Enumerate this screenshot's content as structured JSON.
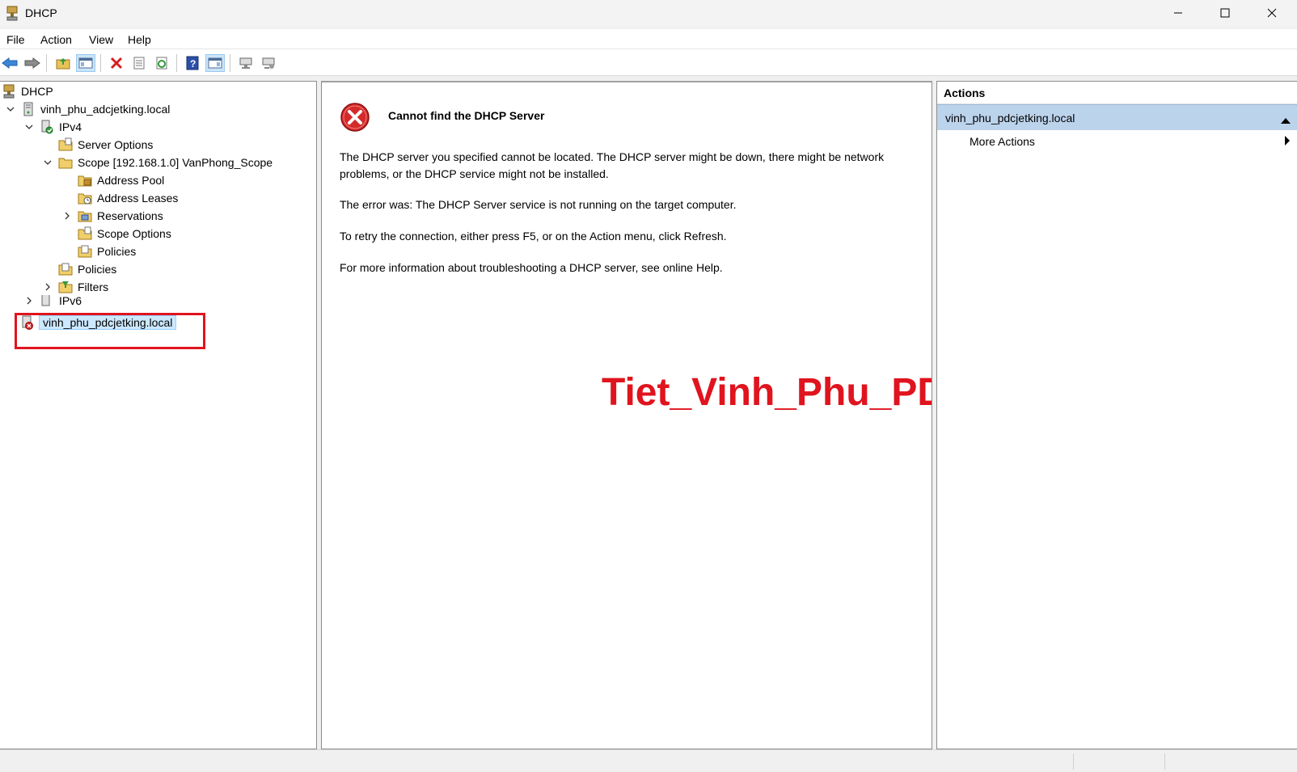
{
  "window": {
    "title": "DHCP",
    "minimize": "—",
    "maximize": "☐",
    "close": "✕"
  },
  "menu": {
    "items": [
      "File",
      "Action",
      "View",
      "Help"
    ]
  },
  "tree": {
    "root": "DHCP",
    "server1": "vinh_phu_adcjetking.local",
    "ipv4": "IPv4",
    "server_options": "Server Options",
    "scope": "Scope [192.168.1.0] VanPhong_Scope",
    "address_pool": "Address Pool",
    "address_leases": "Address Leases",
    "reservations": "Reservations",
    "scope_options": "Scope Options",
    "scope_policies": "Policies",
    "policies": "Policies",
    "filters": "Filters",
    "ipv6": "IPv6",
    "server2": "vinh_phu_pdcjetking.local"
  },
  "center": {
    "error_title": "Cannot find the DHCP Server",
    "msg1": "The DHCP server you specified cannot be located. The DHCP server might be down, there might be network problems, or the DHCP service might not be installed.",
    "msg2": "The error was:  The DHCP Server service is not running on the target computer.",
    "msg3": "To retry the connection, either press F5, or on the Action menu, click Refresh.",
    "msg4": "For more information about troubleshooting a DHCP server, see online Help.",
    "watermark": "Tiet_Vinh_Phu_PDC"
  },
  "actions": {
    "header": "Actions",
    "group": "vinh_phu_pdcjetking.local",
    "more": "More Actions"
  },
  "colors": {
    "accent_red": "#e0141e",
    "selection": "#cce8ff",
    "actions_group_bg": "#bcd3ec"
  }
}
